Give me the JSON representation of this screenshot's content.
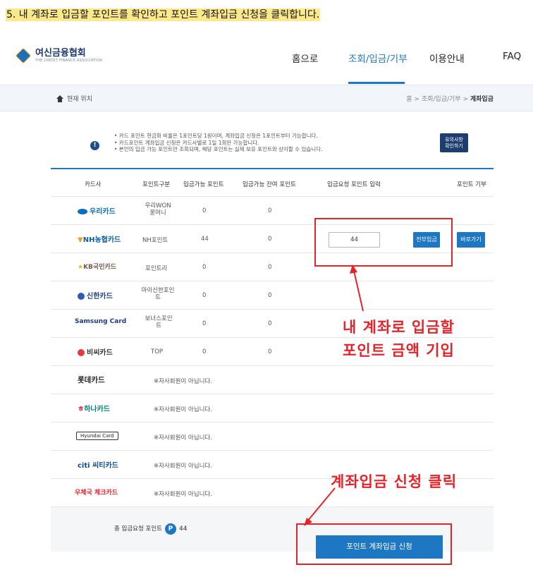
{
  "step_title": "5. 내 계좌로 입금할 포인트를 확인하고 포인트 계좌입금 신청을 클릭합니다.",
  "logo": {
    "name_kr": "여신금융협회",
    "name_en": "THE CREDIT FINANCE ASSOCIATION"
  },
  "nav": {
    "home": "홈으로",
    "inquiry": "조회/입금/기부",
    "guide": "이용안내",
    "faq": "FAQ"
  },
  "breadcrumb": {
    "current_label": "현재 위치",
    "path_home": "홈",
    "path_mid": "조회/입금/기부",
    "path_current": "계좌입금",
    "sep": ">"
  },
  "notice": {
    "lines": [
      "• 카드 포인트 현금화 비율은 1포인트당 1원이며, 계좌입금 신청은 1포인트부터 가능합니다.",
      "• 카드포인트 계좌입금 신청은 카드사별로 1일 1회만 가능합니다.",
      "• 본인의 입금 가능 포인트만 조회되며, 해당 포인트는 실제 보유 포인트와 상이할 수 있습니다."
    ],
    "button_line1": "유의사항",
    "button_line2": "확인하기"
  },
  "table": {
    "headers": [
      "카드사",
      "포인트구분",
      "입금가능 포인트",
      "입금가능 잔여 포인트",
      "입금요청 포인트 입력",
      "포인트 기부"
    ],
    "rows": [
      {
        "card": "우리카드",
        "point_type": "우리WON 꿀머니",
        "available": "0",
        "remaining": "0"
      },
      {
        "card": "NH농협카드",
        "point_type": "NH포인트",
        "available": "44",
        "remaining": "0",
        "input_value": "44",
        "btn_all": "전부입금",
        "btn_direct": "바로가기"
      },
      {
        "card": "KB국민카드",
        "point_type": "포인트리",
        "available": "0",
        "remaining": "0"
      },
      {
        "card": "신한카드",
        "point_type": "마이신한포인트",
        "available": "0",
        "remaining": "0"
      },
      {
        "card": "Samsung Card",
        "point_type": "보너스포인트",
        "available": "0",
        "remaining": "0"
      },
      {
        "card": "비씨카드",
        "point_type": "TOP",
        "available": "0",
        "remaining": "0"
      },
      {
        "card": "롯데카드",
        "note": "※자사회원이 아닙니다."
      },
      {
        "card": "하나카드",
        "note": "※자사회원이 아닙니다."
      },
      {
        "card": "Hyundai Card",
        "note": "※자사회원이 아닙니다."
      },
      {
        "card": "citi 씨티카드",
        "note": "※자사회원이 아닙니다."
      },
      {
        "card": "우체국 체크카드",
        "note": "※자사회원이 아닙니다."
      }
    ],
    "total_label": "총 입금요청 포인트",
    "total_badge": "P",
    "total_value": "44",
    "submit_label": "포인트 계좌입금 신청"
  },
  "annotations": {
    "input_line1": "내 계좌로 입금할",
    "input_line2": "포인트 금액 기입",
    "submit": "계좌입금 신청 클릭",
    "color": "#e5242a"
  },
  "colors": {
    "accent": "#1e77c2",
    "highlight": "#fde98a",
    "navy": "#1c3d6e"
  }
}
